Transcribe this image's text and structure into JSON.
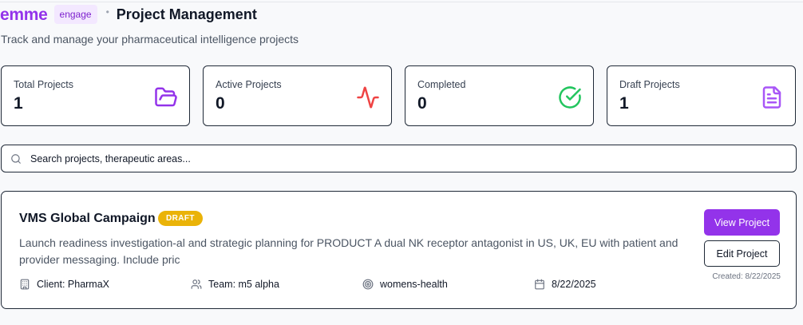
{
  "header": {
    "brand": "emme",
    "badge": "engage",
    "separator": "•",
    "title": "Project Management",
    "subtitle": "Track and manage your pharmaceutical intelligence projects"
  },
  "stats": [
    {
      "label": "Total Projects",
      "value": "1",
      "icon": "folder-open-icon",
      "color": "#9333ea"
    },
    {
      "label": "Active Projects",
      "value": "0",
      "icon": "activity-icon",
      "color": "#ef4444"
    },
    {
      "label": "Completed",
      "value": "0",
      "icon": "check-circle-icon",
      "color": "#22c55e"
    },
    {
      "label": "Draft Projects",
      "value": "1",
      "icon": "file-text-icon",
      "color": "#a855f7"
    }
  ],
  "search": {
    "placeholder": "Search projects, therapeutic areas..."
  },
  "projects": [
    {
      "title": "VMS Global Campaign",
      "status": "DRAFT",
      "status_color": "#eab308",
      "description": "Launch readiness investigation-al and strategic planning for PRODUCT A dual NK receptor antagonist in US, UK, EU with patient and provider messaging. Include pric",
      "client": "Client: PharmaX",
      "team": "Team: m5 alpha",
      "area": "womens-health",
      "date": "8/22/2025",
      "view_label": "View Project",
      "edit_label": "Edit Project",
      "created": "Created: 8/22/2025"
    }
  ],
  "colors": {
    "accent": "#9333ea",
    "border": "#1f2937",
    "background": "#f8f9fb"
  }
}
